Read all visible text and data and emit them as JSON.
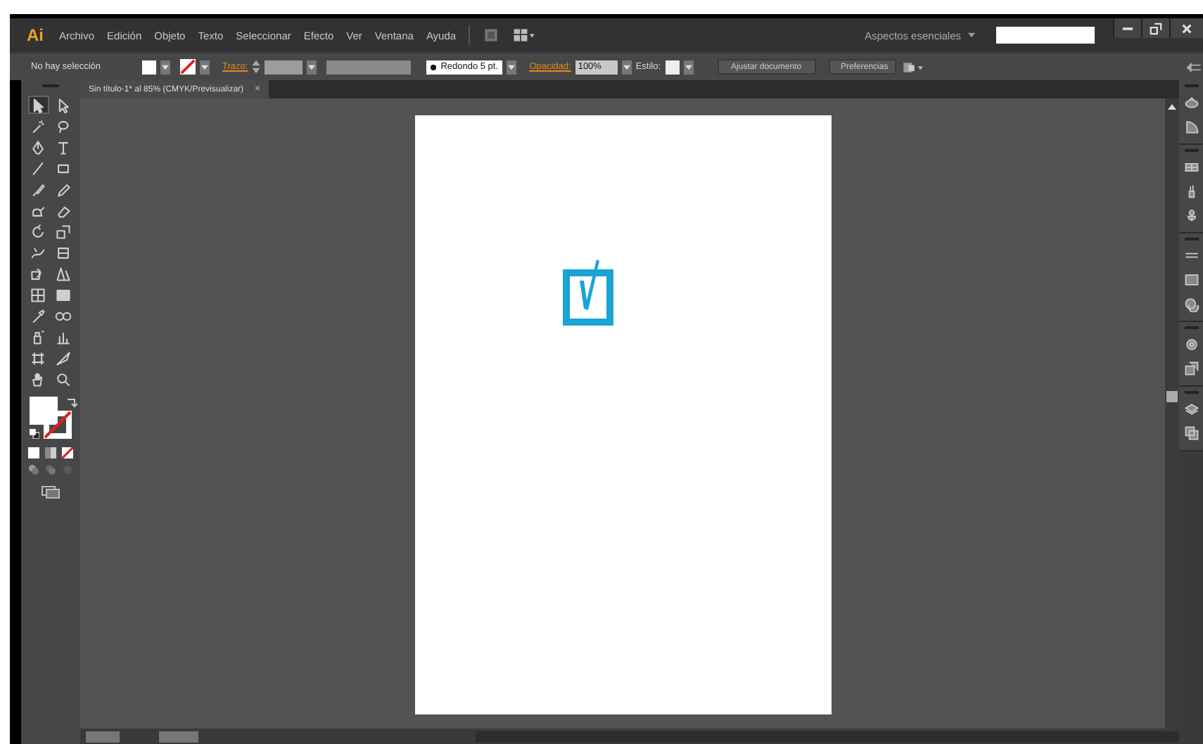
{
  "app_logo": "Ai",
  "menu": [
    "Archivo",
    "Edición",
    "Objeto",
    "Texto",
    "Seleccionar",
    "Efecto",
    "Ver",
    "Ventana",
    "Ayuda"
  ],
  "workspace": "Aspectos esenciales",
  "control_bar": {
    "selection": "No hay selección",
    "stroke_label": "Trazo:",
    "brush": "Redondo 5 pt.",
    "opacity_label": "Opacidad:",
    "opacity": "100%",
    "style_label": "Estilo:",
    "buttons": [
      "Ajustar documento",
      "Preferencias"
    ]
  },
  "document_tab": {
    "title": "Sin título-1* al 85% (CMYK/Previsualizar)",
    "close": "×"
  },
  "tools": [
    {
      "kind": "select",
      "selected": true
    },
    {
      "kind": "direct-select",
      "selected": false
    },
    {
      "kind": "wand",
      "selected": false
    },
    {
      "kind": "lasso",
      "selected": false
    },
    {
      "kind": "pen",
      "selected": false
    },
    {
      "kind": "type",
      "selected": false
    },
    {
      "kind": "line",
      "selected": false
    },
    {
      "kind": "rectangle",
      "selected": false
    },
    {
      "kind": "brush",
      "selected": false
    },
    {
      "kind": "pencil",
      "selected": false
    },
    {
      "kind": "blob",
      "selected": false
    },
    {
      "kind": "eraser",
      "selected": false
    },
    {
      "kind": "rotate",
      "selected": false
    },
    {
      "kind": "scale",
      "selected": false
    },
    {
      "kind": "warp",
      "selected": false
    },
    {
      "kind": "free-transform",
      "selected": false
    },
    {
      "kind": "shape-builder",
      "selected": false
    },
    {
      "kind": "perspective",
      "selected": false
    },
    {
      "kind": "mesh",
      "selected": false
    },
    {
      "kind": "gradient",
      "selected": false
    },
    {
      "kind": "eyedropper",
      "selected": false
    },
    {
      "kind": "blend",
      "selected": false
    },
    {
      "kind": "sprayer",
      "selected": false
    },
    {
      "kind": "graph",
      "selected": false
    },
    {
      "kind": "artboard",
      "selected": false
    },
    {
      "kind": "slice",
      "selected": false
    },
    {
      "kind": "hand",
      "selected": false
    },
    {
      "kind": "zoom",
      "selected": false
    }
  ]
}
